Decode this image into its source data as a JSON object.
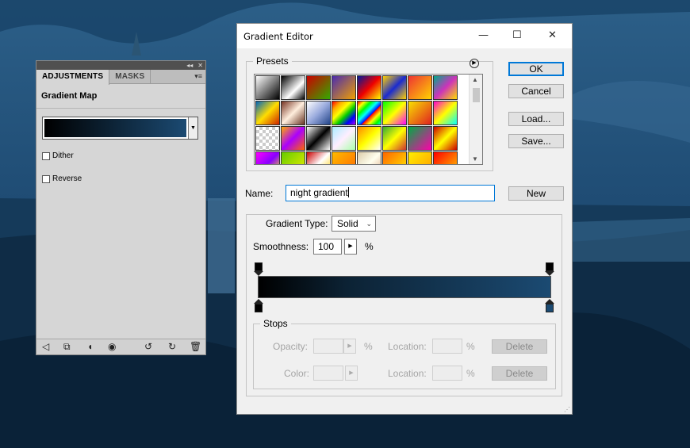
{
  "adjustments_panel": {
    "tabs": [
      "ADJUSTMENTS",
      "MASKS"
    ],
    "title": "Gradient Map",
    "dither_label": "Dither",
    "reverse_label": "Reverse",
    "dither_checked": false,
    "reverse_checked": false,
    "footer_icons": [
      "back-arrow-icon",
      "clip-layer-icon",
      "visibility-mask-icon",
      "eye-icon",
      "previous-state-icon",
      "reset-icon",
      "trash-icon"
    ]
  },
  "gradient_editor": {
    "window_title": "Gradient Editor",
    "presets_label": "Presets",
    "buttons": {
      "ok": "OK",
      "cancel": "Cancel",
      "load": "Load...",
      "save": "Save...",
      "new": "New",
      "delete": "Delete"
    },
    "name_label": "Name:",
    "name_value": "night gradient",
    "gradient_type_label": "Gradient Type:",
    "gradient_type_value": "Solid",
    "smoothness_label": "Smoothness:",
    "smoothness_value": "100",
    "percent": "%",
    "stops": {
      "group_label": "Stops",
      "opacity_label": "Opacity:",
      "color_label": "Color:",
      "location_label": "Location:"
    },
    "gradient_colors": {
      "start": "#000000",
      "end": "#1b4a72"
    }
  },
  "colors": {
    "accent": "#0078d7",
    "desktop_bg": "#1d4a70"
  }
}
